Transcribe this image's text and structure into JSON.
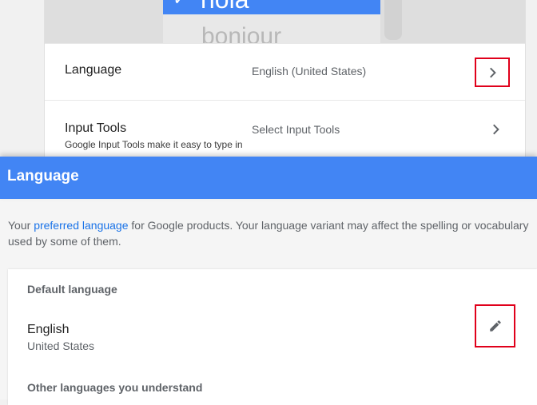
{
  "illustration": {
    "selected_word": "hola",
    "next_word": "bonjour",
    "check_glyph": "✔"
  },
  "settings": {
    "rows": [
      {
        "title": "Language",
        "value": "English (United States)",
        "description": "",
        "icon": "chevron-right-icon"
      },
      {
        "title": "Input Tools",
        "value": "Select Input Tools",
        "description": "Google Input Tools make it easy to type in",
        "icon": "chevron-right-icon"
      }
    ]
  },
  "panel": {
    "title": "Language",
    "intro_prefix": "Your ",
    "intro_link": "preferred language",
    "intro_suffix": " for Google products. Your language variant may affect the spelling or vocabulary used by some of them.",
    "default_label": "Default language",
    "default_language": "English",
    "default_region": "United States",
    "other_label": "Other languages you understand",
    "edit_icon": "pencil-icon"
  },
  "colors": {
    "accent": "#4285f4",
    "link": "#1a73e8",
    "highlight": "#e0001b"
  }
}
